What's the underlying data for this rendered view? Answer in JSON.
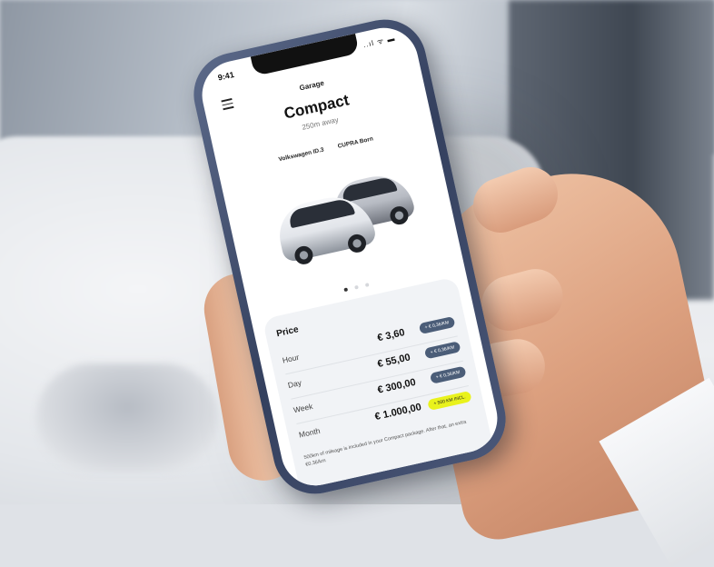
{
  "status": {
    "time": "9:41",
    "icons": "..ıl ᯤ ▬"
  },
  "header": {
    "screen_label": "Garage",
    "title": "Compact",
    "distance": "250m away"
  },
  "models": [
    "Volkswagen ID.3",
    "CUPRA Born"
  ],
  "carousel": {
    "count": 3,
    "active": 0
  },
  "price": {
    "heading": "Price",
    "rows": [
      {
        "label": "Hour",
        "amount": "€ 3,60",
        "tag": "+ € 0,36/KM"
      },
      {
        "label": "Day",
        "amount": "€ 55,00",
        "tag": "+ € 0,36/KM"
      },
      {
        "label": "Week",
        "amount": "€ 300,00",
        "tag": "+ € 0,36/KM"
      },
      {
        "label": "Month",
        "amount": "€ 1.000,00",
        "tag": "+ 500 KM INCL."
      }
    ],
    "note": "500km of mileage is included in your Compact package. After that, an extra €0.36/km"
  },
  "colors": {
    "accent": "#e9f21c",
    "tag": "#4b5d78",
    "frame": "#3b4766"
  }
}
